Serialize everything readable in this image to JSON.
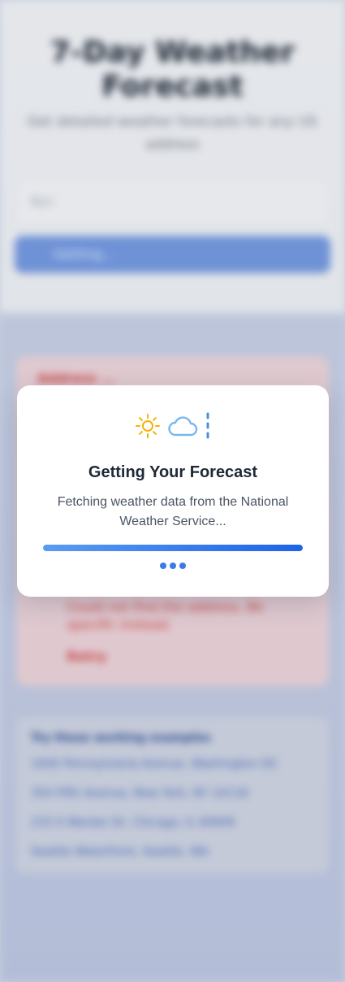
{
  "background_page": {
    "title": "7-Day Weather Forecast",
    "subtitle": "Get detailed weather forecasts for any US address",
    "address_input": {
      "value": "Nyc"
    },
    "submit_button": {
      "label": "Getting..."
    },
    "error_box": {
      "heading": "Address ...",
      "message": "Could not find the address. Be specific instead.",
      "retry_label": "Retry"
    },
    "tips": {
      "heading": "Try these working examples",
      "items": [
        "1600 Pennsylvania Avenue, Washington DC",
        "350 Fifth Avenue, New York, NY 10118",
        "233 S Wacker Dr, Chicago, IL 60606",
        "Seattle Waterfront, Seattle, WA"
      ]
    }
  },
  "loading_modal": {
    "title": "Getting Your Forecast",
    "message": "Fetching weather data from the National Weather Service...",
    "progress_percent": 100,
    "icons": [
      "sun-icon",
      "cloud-icon",
      "rain-icon"
    ],
    "colors": {
      "sun": "#f5b301",
      "cloud": "#7ab6f0",
      "rain": "#4a90e2",
      "progress_start": "#5b9cf2",
      "progress_end": "#1d63e8",
      "dots": "#3b7be8"
    }
  }
}
